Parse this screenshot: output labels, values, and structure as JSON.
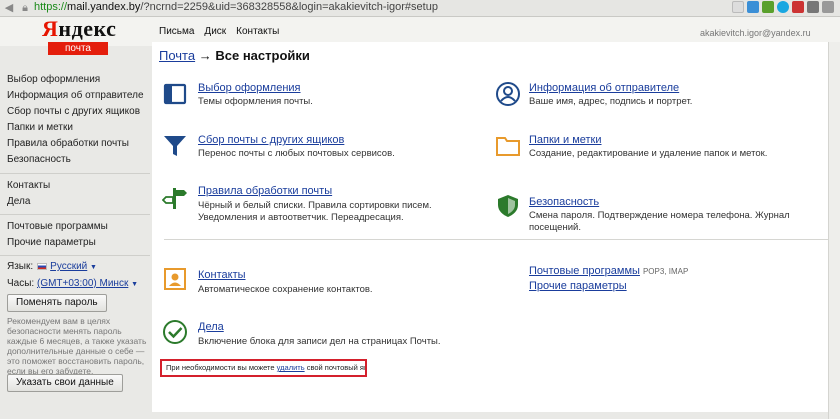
{
  "browser": {
    "url_scheme": "https://",
    "url_host": "mail.yandex.by",
    "url_rest": "/?ncrnd=2259&uid=368328558&login=akakievitch-igor#setup"
  },
  "header": {
    "logo_text": "Яндекс",
    "logo_first": "Я",
    "logo_rest": "ндекс",
    "badge": "почта",
    "user_email": "akakievitch.igor@yandex.ru",
    "nav": [
      "Письма",
      "Диск",
      "Контакты"
    ]
  },
  "breadcrumb": {
    "link": "Почта",
    "arrow": "→",
    "current": "Все настройки"
  },
  "sidebar": {
    "group1": [
      "Выбор оформления",
      "Информация об отправителе",
      "Сбор почты с других ящиков",
      "Папки и метки",
      "Правила обработки почты",
      "Безопасность"
    ],
    "group2": [
      "Контакты",
      "Дела"
    ],
    "group3": [
      "Почтовые программы",
      "Прочие параметры"
    ],
    "language_label": "Язык:",
    "language_value": "Русский",
    "timezone_label": "Часы:",
    "timezone_value": "(GMT+03:00) Минск",
    "change_password_button": "Поменять пароль",
    "advice": "Рекомендуем вам в целях безопасности менять пароль каждые 6 месяцев, а также указать дополнительные данные о себе — это поможет восстановить пароль, если вы его забудете.",
    "your_data_button": "Указать свои данные"
  },
  "sections": {
    "design": {
      "title": "Выбор оформления",
      "desc": "Темы оформления почты."
    },
    "sender": {
      "title": "Информация об отправителе",
      "desc": "Ваше имя, адрес, подпись и портрет."
    },
    "collect": {
      "title": "Сбор почты с других ящиков",
      "desc": "Перенос почты с любых почтовых сервисов."
    },
    "folders": {
      "title": "Папки и метки",
      "desc": "Создание, редактирование и удаление папок и меток."
    },
    "rules": {
      "title": "Правила обработки почты",
      "desc": "Чёрный и белый списки. Правила сортировки писем. Уведомления и автоответчик. Переадресация."
    },
    "security": {
      "title": "Безопасность",
      "desc": "Смена пароля. Подтверждение номера телефона. Журнал посещений."
    },
    "contacts": {
      "title": "Контакты",
      "desc": "Автоматическое сохранение контактов."
    },
    "todo": {
      "title": "Дела",
      "desc": "Включение блока для записи дел на страницах Почты."
    },
    "mail_programs": {
      "title": "Почтовые программы",
      "note": "POP3, IMAP"
    },
    "other_params": {
      "title": "Прочие параметры"
    }
  },
  "notice": {
    "before": "При необходимости вы можете ",
    "link": "удалить",
    "after": " свой почтовый ящик."
  },
  "colors": {
    "link": "#1a3d9c",
    "brand_red": "#e41e0c",
    "highlight_box": "#d4202c",
    "icon_blue": "#1f4a8a",
    "icon_orange": "#e89a2c",
    "icon_green": "#2b7a2b"
  }
}
